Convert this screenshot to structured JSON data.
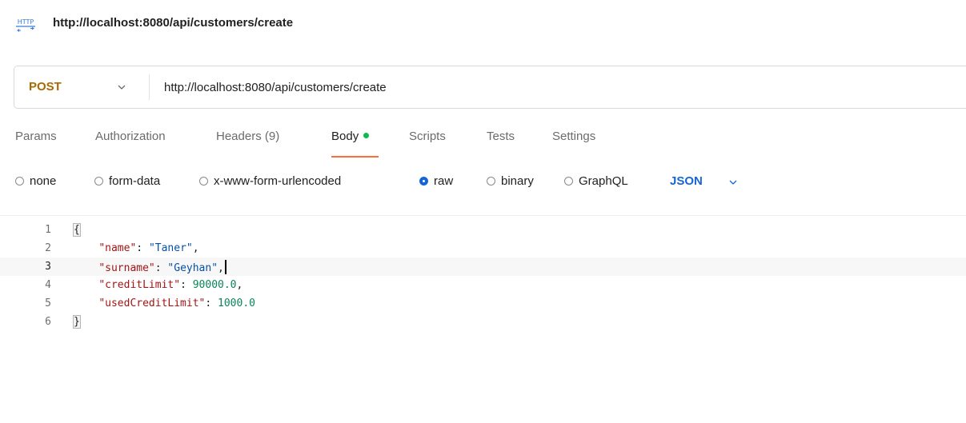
{
  "header": {
    "icon": "http-file-icon",
    "icon_text": "HTTP",
    "title": "http://localhost:8080/api/customers/create"
  },
  "request": {
    "method": "POST",
    "url": "http://localhost:8080/api/customers/create"
  },
  "tabs": [
    {
      "label": "Params"
    },
    {
      "label": "Authorization"
    },
    {
      "label": "Headers (9)"
    },
    {
      "label": "Body",
      "active": true
    },
    {
      "label": "Scripts"
    },
    {
      "label": "Tests"
    },
    {
      "label": "Settings"
    }
  ],
  "body_types": [
    {
      "label": "none",
      "checked": false
    },
    {
      "label": "form-data",
      "checked": false
    },
    {
      "label": "x-www-form-urlencoded",
      "checked": false
    },
    {
      "label": "raw",
      "checked": true
    },
    {
      "label": "binary",
      "checked": false
    },
    {
      "label": "GraphQL",
      "checked": false
    }
  ],
  "format": "JSON",
  "editor": {
    "current_line": 3,
    "lines": [
      {
        "number": "1",
        "open": "{"
      },
      {
        "number": "2",
        "key": "\"name\"",
        "value": "\"Taner\"",
        "value_type": "string",
        "trail": ","
      },
      {
        "number": "3",
        "key": "\"surname\"",
        "value": "\"Geyhan\"",
        "value_type": "string",
        "trail": ","
      },
      {
        "number": "4",
        "key": "\"creditLimit\"",
        "value": "90000.0",
        "value_type": "number",
        "trail": ","
      },
      {
        "number": "5",
        "key": "\"usedCreditLimit\"",
        "value": "1000.0",
        "value_type": "number",
        "trail": ""
      },
      {
        "number": "6",
        "close": "}"
      }
    ]
  },
  "colors": {
    "method": "#a86a00",
    "active_tab_underline": "#ff6c37",
    "body_dot": "#0cbb52",
    "accent_blue": "#1565d8",
    "json_key": "#a31515",
    "json_string": "#0451a5",
    "json_number": "#098658"
  }
}
